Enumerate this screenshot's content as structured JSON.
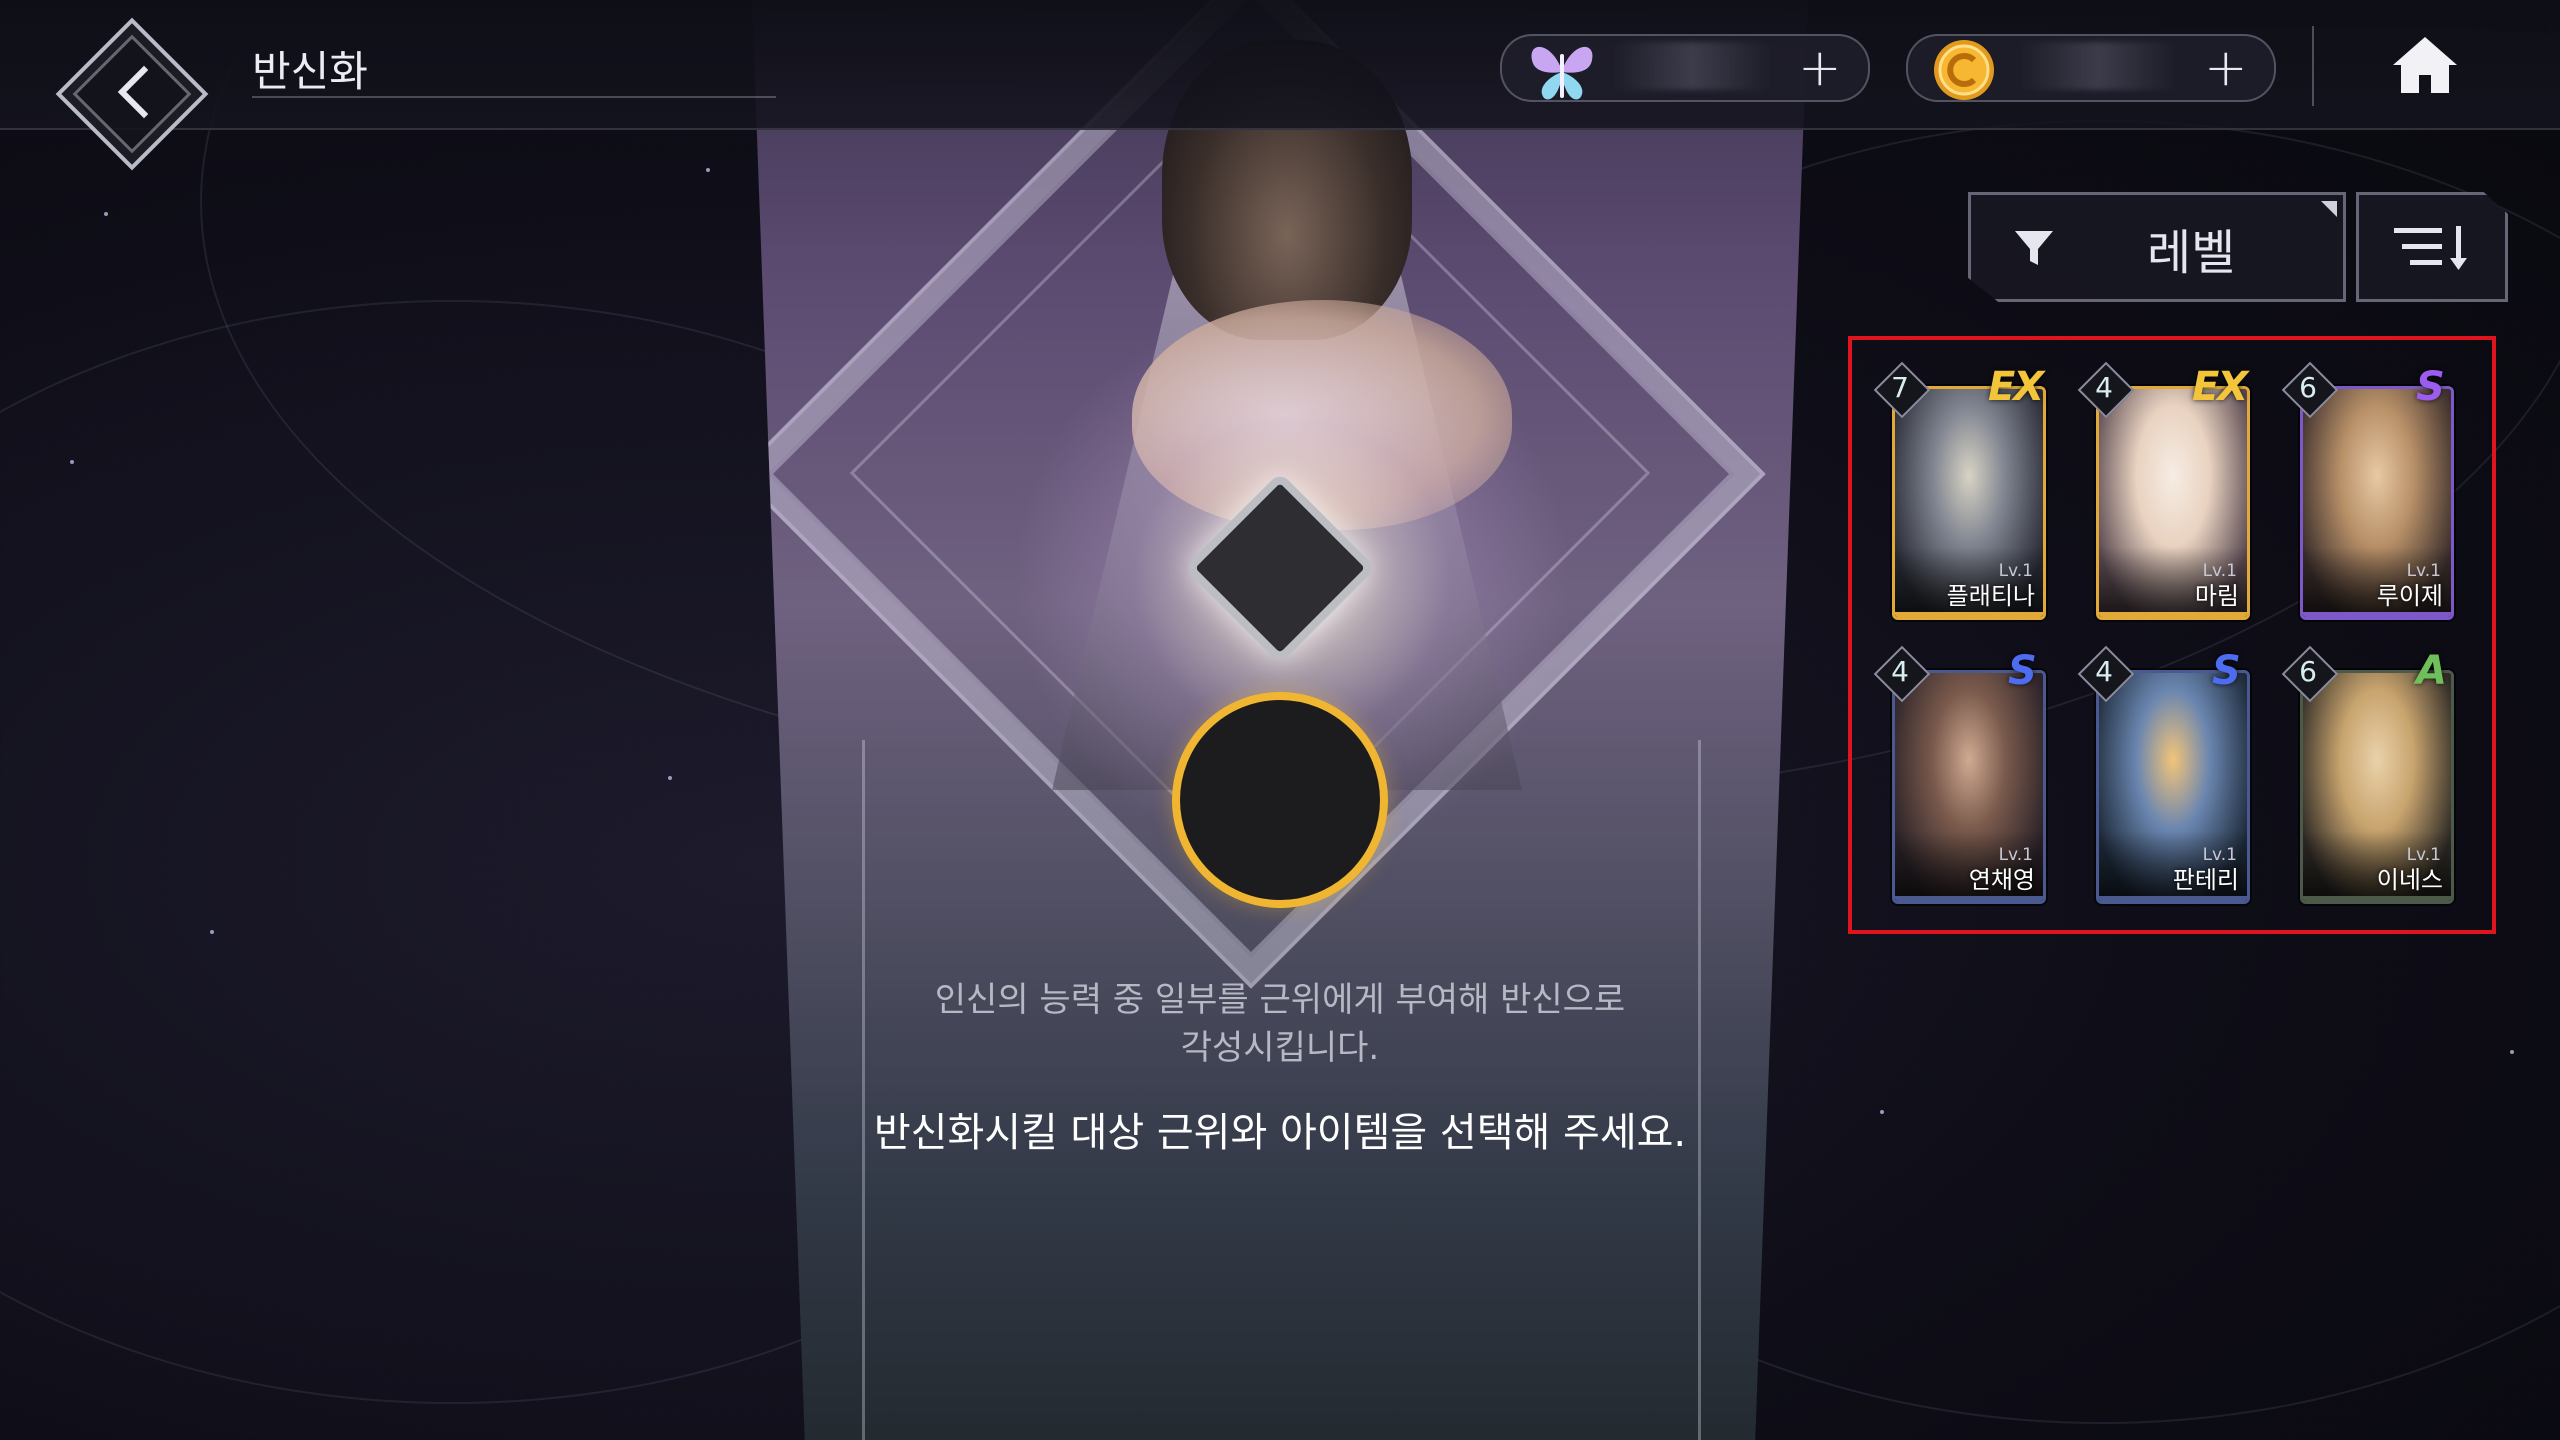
{
  "header": {
    "title": "반신화",
    "resources": [
      {
        "icon": "butterfly-icon",
        "value": "",
        "plus": "+"
      },
      {
        "icon": "gold-coin-icon",
        "value": "",
        "plus": "+"
      }
    ]
  },
  "filter": {
    "label": "레벨"
  },
  "center": {
    "description_line1": "인신의 능력 중 일부를 근위에게 부여해 반신으로",
    "description_line2": "각성시킵니다.",
    "instruction": "반신화시킬 대상 근위와 아이템을 선택해 주세요."
  },
  "heroes": [
    {
      "name": "플래티나",
      "level": "Lv.1",
      "stars": "7",
      "grade": "EX",
      "grade_color": "#f2c53a",
      "frame_color": "#e1a938"
    },
    {
      "name": "마림",
      "level": "Lv.1",
      "stars": "4",
      "grade": "EX",
      "grade_color": "#f2c53a",
      "frame_color": "#e1a938"
    },
    {
      "name": "루이제",
      "level": "Lv.1",
      "stars": "6",
      "grade": "S",
      "grade_color": "#9b5cf0",
      "frame_color": "#7c58c8"
    },
    {
      "name": "연채영",
      "level": "Lv.1",
      "stars": "4",
      "grade": "S",
      "grade_color": "#4e6cf0",
      "frame_color": "#4a5a90"
    },
    {
      "name": "판테리",
      "level": "Lv.1",
      "stars": "4",
      "grade": "S",
      "grade_color": "#4e6cf0",
      "frame_color": "#4a5a90"
    },
    {
      "name": "이네스",
      "level": "Lv.1",
      "stars": "6",
      "grade": "A",
      "grade_color": "#6fbf5a",
      "frame_color": "#4d5a4a"
    }
  ],
  "colors": {
    "accent_gold": "#f0b632",
    "highlight_red": "#e0141e"
  }
}
